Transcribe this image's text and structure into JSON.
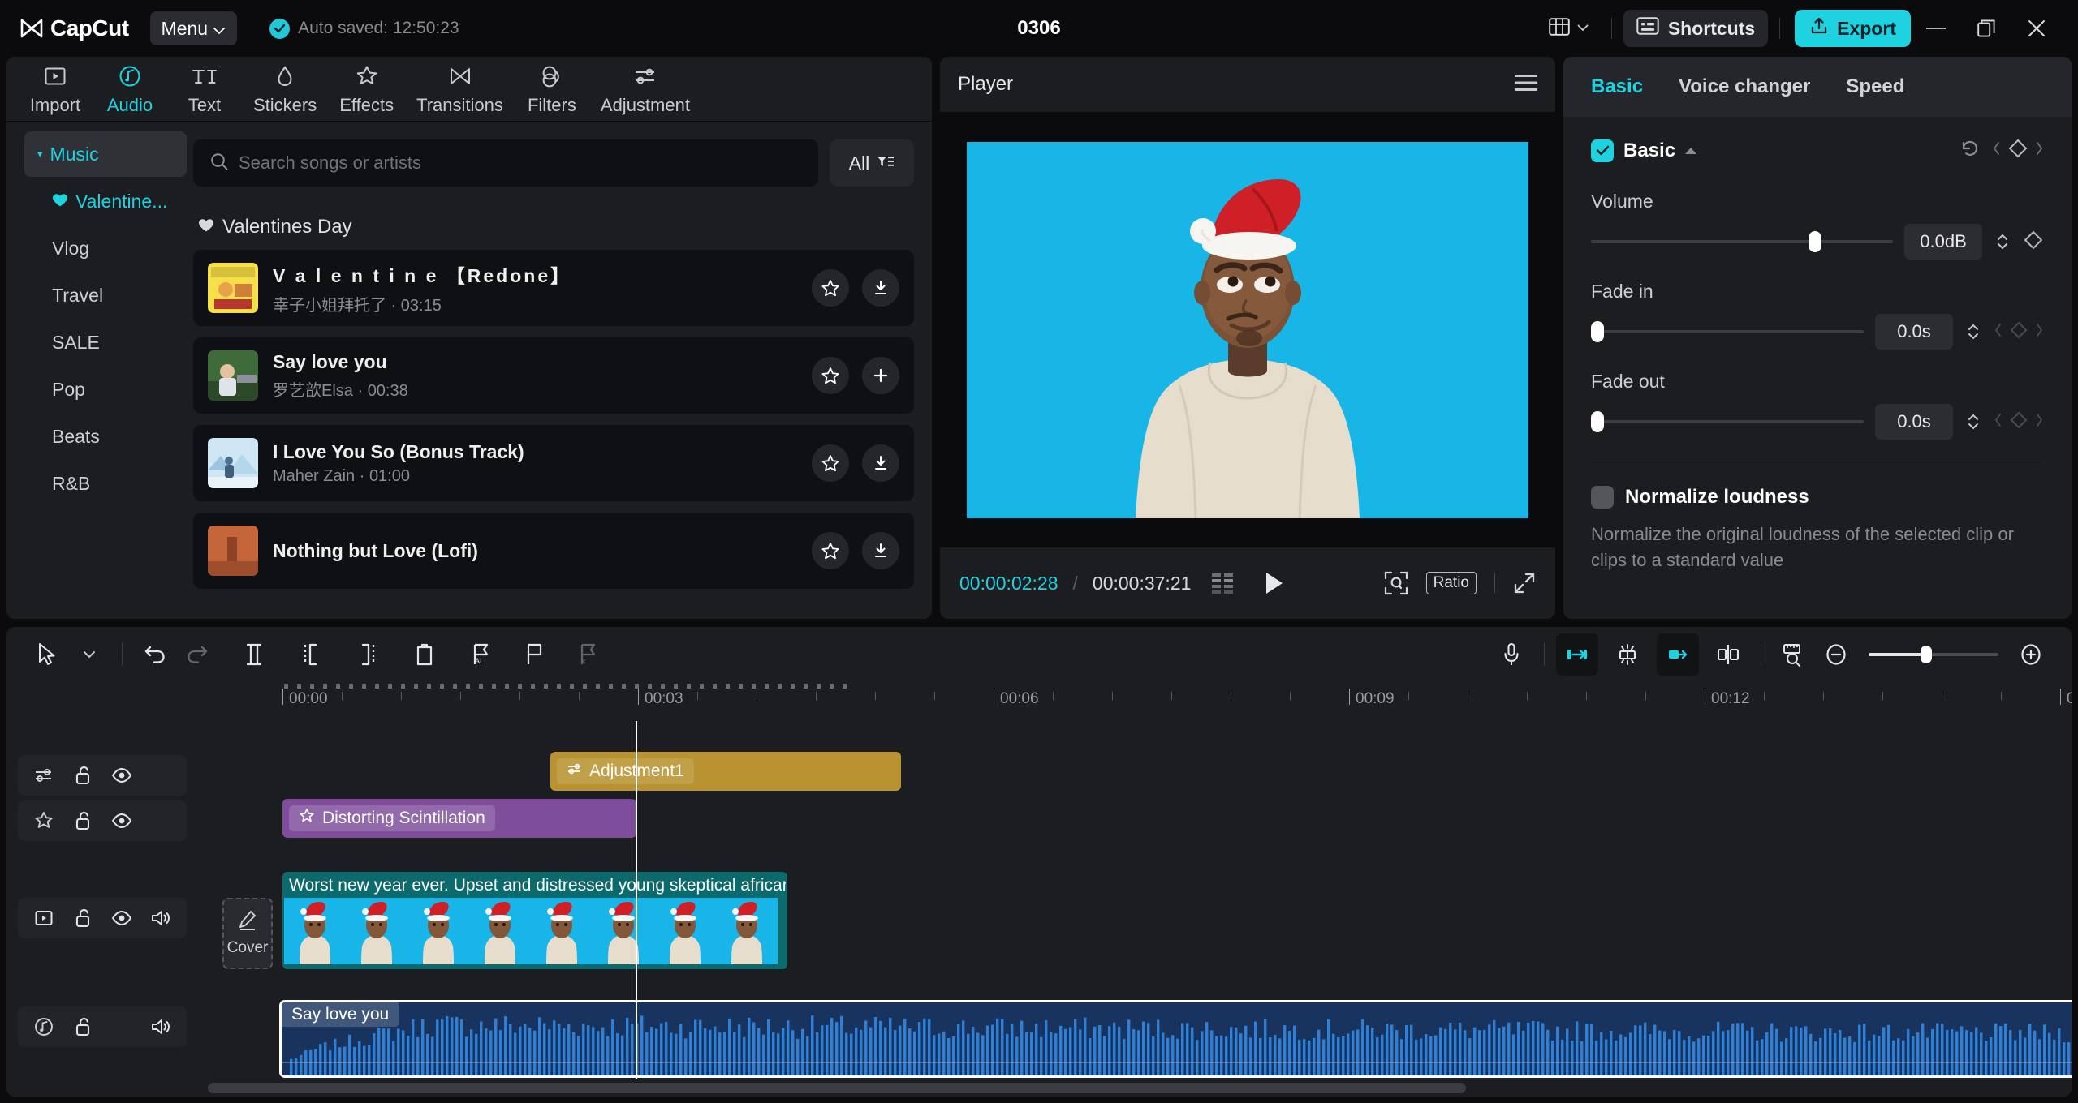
{
  "titlebar": {
    "brand": "CapCut",
    "menu_label": "Menu",
    "autosave_text": "Auto saved: 12:50:23",
    "project_title": "0306",
    "shortcuts_label": "Shortcuts",
    "export_label": "Export",
    "layout_icon": "layout-icon",
    "minimize_icon": "minimize-icon",
    "maximize_icon": "maximize-icon",
    "close_icon": "close-icon",
    "accent": "#1ed2e0"
  },
  "tabs": [
    {
      "label": "Import",
      "icon": "import-icon",
      "active": false
    },
    {
      "label": "Audio",
      "icon": "audio-note-icon",
      "active": true
    },
    {
      "label": "Text",
      "icon": "text-ti-icon",
      "active": false
    },
    {
      "label": "Stickers",
      "icon": "sticker-drop-icon",
      "active": false
    },
    {
      "label": "Effects",
      "icon": "effects-star-icon",
      "active": false
    },
    {
      "label": "Transitions",
      "icon": "transitions-icon",
      "active": false
    },
    {
      "label": "Filters",
      "icon": "filters-rings-icon",
      "active": false
    },
    {
      "label": "Adjustment",
      "icon": "adjustment-sliders-icon",
      "active": false
    }
  ],
  "categories": [
    {
      "label": "Music",
      "type": "group",
      "expanded": true
    },
    {
      "label": "Valentine...",
      "type": "sub",
      "active": true,
      "icon": "heart-icon"
    },
    {
      "label": "Vlog",
      "type": "sub",
      "active": false
    },
    {
      "label": "Travel",
      "type": "sub",
      "active": false
    },
    {
      "label": "SALE",
      "type": "sub",
      "active": false
    },
    {
      "label": "Pop",
      "type": "sub",
      "active": false
    },
    {
      "label": "Beats",
      "type": "sub",
      "active": false
    },
    {
      "label": "R&B",
      "type": "sub",
      "active": false
    }
  ],
  "search": {
    "placeholder": "Search songs or artists",
    "value": ""
  },
  "filter": {
    "label": "All",
    "icon": "filter-icon"
  },
  "song_section": {
    "title": "Valentines Day",
    "icon": "heart-icon"
  },
  "songs": [
    {
      "title": "V a l e n t i n e 【Redone】",
      "artist": "幸子小姐拜托了",
      "duration": "03:15",
      "action": "download",
      "spaced": true,
      "art": "yellow"
    },
    {
      "title": "Say love you",
      "artist": "罗艺歆Elsa",
      "duration": "00:38",
      "action": "add",
      "spaced": false,
      "art": "piano"
    },
    {
      "title": "I Love You So (Bonus Track)",
      "artist": "Maher Zain",
      "duration": "01:00",
      "action": "download",
      "spaced": false,
      "art": "snow"
    },
    {
      "title": "Nothing but Love (Lofi)",
      "artist": "",
      "duration": "",
      "action": "download",
      "spaced": false,
      "art": "orange"
    }
  ],
  "player": {
    "title": "Player",
    "menu_icon": "hamburger-icon",
    "current_time": "00:00:02:28",
    "total_time": "00:00:37:21",
    "separator": "/",
    "frames_icon": "frames-icon",
    "play_icon": "play-icon",
    "zoom_fit_icon": "zoom-fit-icon",
    "ratio_label": "Ratio",
    "fullscreen_icon": "fullscreen-icon"
  },
  "inspector": {
    "tabs": [
      {
        "label": "Basic",
        "active": true
      },
      {
        "label": "Voice changer",
        "active": false
      },
      {
        "label": "Speed",
        "active": false
      }
    ],
    "section_title": "Basic",
    "section_checked": true,
    "reset_icon": "reset-icon",
    "keyframe_icon": "keyframe-diamond-icon",
    "fields": [
      {
        "label": "Volume",
        "value": "0.0dB",
        "knob_pct": 72
      },
      {
        "label": "Fade in",
        "value": "0.0s",
        "knob_pct": 0
      },
      {
        "label": "Fade out",
        "value": "0.0s",
        "knob_pct": 0
      }
    ],
    "normalize": {
      "title": "Normalize loudness",
      "enabled": false,
      "description": "Normalize the original loudness of the selected clip or clips to a standard value"
    }
  },
  "timeline": {
    "toolbar_left": [
      {
        "name": "select-cursor-tool",
        "icon": "cursor-icon",
        "disabled": false
      },
      {
        "name": "tool-dropdown",
        "icon": "chevron-down-icon",
        "disabled": false
      },
      {
        "name": "undo-button",
        "icon": "undo-icon",
        "disabled": false
      },
      {
        "name": "redo-button",
        "icon": "redo-icon",
        "disabled": true
      },
      {
        "name": "split-button",
        "icon": "split-icon",
        "disabled": false
      },
      {
        "name": "trim-left-button",
        "icon": "trim-left-icon",
        "disabled": false
      },
      {
        "name": "trim-right-button",
        "icon": "trim-right-icon",
        "disabled": false
      },
      {
        "name": "delete-button",
        "icon": "trash-icon",
        "disabled": false
      },
      {
        "name": "ai-marker-button",
        "icon": "flag-ai-icon",
        "disabled": false
      },
      {
        "name": "marker-button",
        "icon": "flag-icon",
        "disabled": false
      },
      {
        "name": "remove-marker-button",
        "icon": "flag-x-icon",
        "disabled": true
      }
    ],
    "toolbar_right": [
      {
        "name": "record-voiceover-button",
        "icon": "microphone-icon",
        "active": false
      },
      {
        "name": "auto-snap-left-button",
        "icon": "snap-left-icon",
        "active": true
      },
      {
        "name": "magnet-snap-button",
        "icon": "magnet-icon",
        "active": false
      },
      {
        "name": "link-clips-button",
        "icon": "link-icon",
        "active": true
      },
      {
        "name": "detach-audio-button",
        "icon": "detach-icon",
        "active": false
      },
      {
        "name": "fit-timeline-button",
        "icon": "ruler-fit-icon",
        "active": false
      }
    ],
    "zoom": {
      "out_icon": "zoom-out-icon",
      "in_icon": "zoom-in-icon",
      "level_pct": 42
    },
    "ruler_labels": [
      "00:00",
      "00:03",
      "00:06",
      "00:09",
      "00:12",
      "0"
    ],
    "playhead_time": "00:03",
    "tracks": [
      {
        "name": "adjustment-track",
        "header_icons": [
          "adjustment-sliders-icon",
          "unlock-icon",
          "eye-icon",
          "blank-icon"
        ],
        "clips": [
          {
            "label": "Adjustment1",
            "icon": "adjustment-sliders-icon",
            "type": "adjustment"
          }
        ]
      },
      {
        "name": "effect-track",
        "header_icons": [
          "effects-star-icon",
          "unlock-icon",
          "eye-icon",
          "blank-icon"
        ],
        "clips": [
          {
            "label": "Distorting Scintillation",
            "icon": "effects-star-icon",
            "type": "effect"
          }
        ]
      },
      {
        "name": "video-track",
        "header_icons": [
          "video-icon",
          "unlock-icon",
          "eye-icon",
          "volume-icon"
        ],
        "cover_label": "Cover",
        "cover_icon": "pen-icon",
        "clips": [
          {
            "label": "Worst new year ever. Upset and distressed young skeptical african-a",
            "type": "video"
          }
        ]
      },
      {
        "name": "audio-track",
        "header_icons": [
          "audio-note-icon",
          "unlock-icon",
          "blank-icon",
          "volume-icon"
        ],
        "clips": [
          {
            "label": "Say love you",
            "type": "audio"
          }
        ]
      }
    ]
  }
}
